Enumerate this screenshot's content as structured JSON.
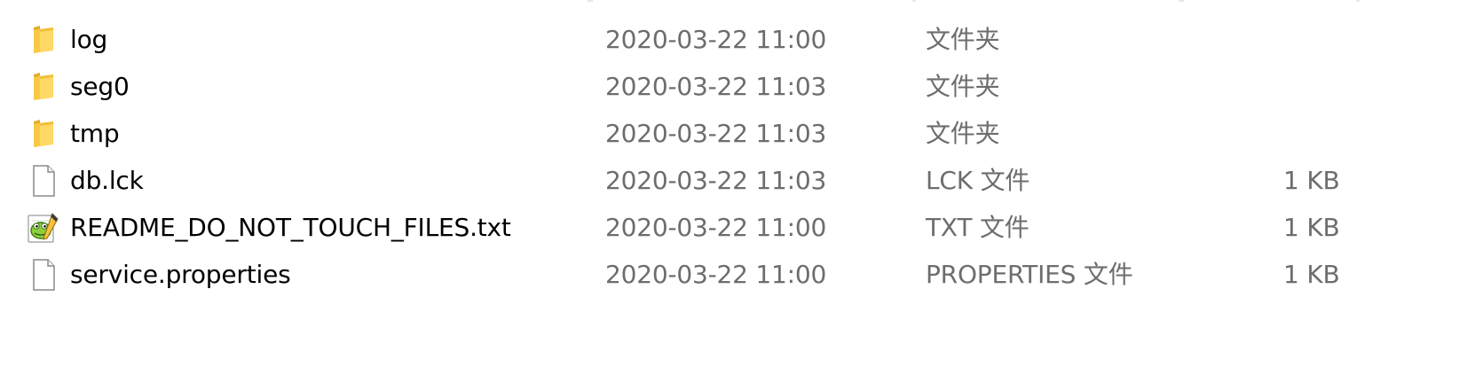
{
  "files": [
    {
      "name": "log",
      "date": "2020-03-22 11:00",
      "type": "文件夹",
      "size": "",
      "icon": "folder-icon"
    },
    {
      "name": "seg0",
      "date": "2020-03-22 11:03",
      "type": "文件夹",
      "size": "",
      "icon": "folder-icon"
    },
    {
      "name": "tmp",
      "date": "2020-03-22 11:03",
      "type": "文件夹",
      "size": "",
      "icon": "folder-icon"
    },
    {
      "name": "db.lck",
      "date": "2020-03-22 11:03",
      "type": "LCK 文件",
      "size": "1 KB",
      "icon": "file-icon"
    },
    {
      "name": "README_DO_NOT_TOUCH_FILES.txt",
      "date": "2020-03-22 11:00",
      "type": "TXT 文件",
      "size": "1 KB",
      "icon": "notepad-plus-plus-icon"
    },
    {
      "name": "service.properties",
      "date": "2020-03-22 11:00",
      "type": "PROPERTIES 文件",
      "size": "1 KB",
      "icon": "file-icon"
    }
  ],
  "colors": {
    "folder": "#f8c946",
    "text_primary": "#000000",
    "text_secondary": "#6d6d6d"
  }
}
